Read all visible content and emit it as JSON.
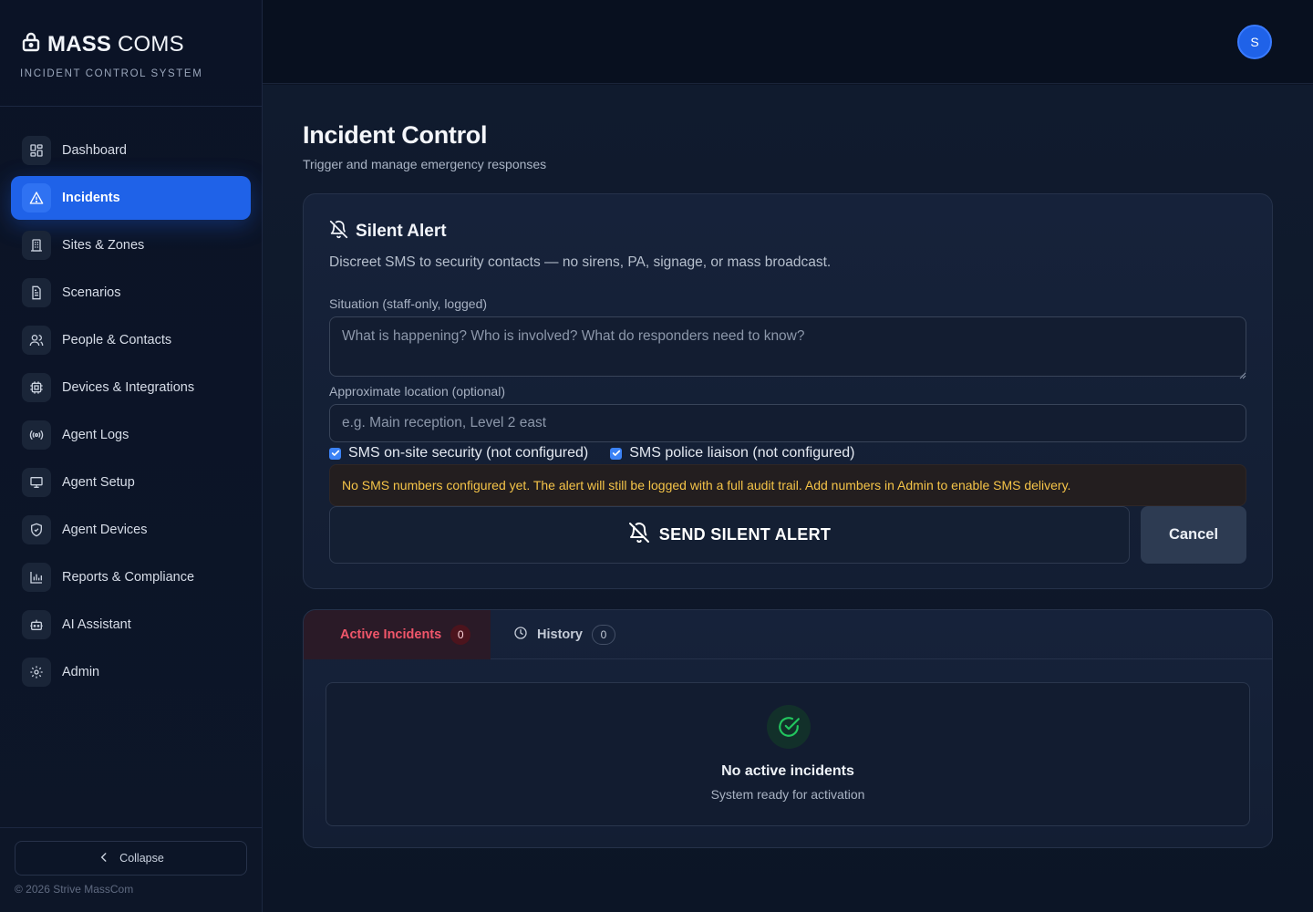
{
  "brand": {
    "name_bold": "MASS",
    "name_light": "COMS",
    "subtitle": "INCIDENT CONTROL SYSTEM"
  },
  "sidebar": {
    "items": [
      {
        "label": "Dashboard",
        "icon": "dashboard-icon"
      },
      {
        "label": "Incidents",
        "icon": "alert-triangle-icon",
        "active": true
      },
      {
        "label": "Sites & Zones",
        "icon": "building-icon"
      },
      {
        "label": "Scenarios",
        "icon": "document-icon"
      },
      {
        "label": "People & Contacts",
        "icon": "users-icon"
      },
      {
        "label": "Devices & Integrations",
        "icon": "chip-icon"
      },
      {
        "label": "Agent Logs",
        "icon": "broadcast-icon"
      },
      {
        "label": "Agent Setup",
        "icon": "monitor-icon"
      },
      {
        "label": "Agent Devices",
        "icon": "shield-icon"
      },
      {
        "label": "Reports & Compliance",
        "icon": "bar-chart-icon"
      },
      {
        "label": "AI Assistant",
        "icon": "bot-icon"
      },
      {
        "label": "Admin",
        "icon": "gear-icon"
      }
    ],
    "collapse_label": "Collapse",
    "copyright": "© 2026 Strive MassCom"
  },
  "header": {
    "avatar_initial": "S"
  },
  "page": {
    "title": "Incident Control",
    "subtitle": "Trigger and manage emergency responses"
  },
  "silent_alert": {
    "title": "Silent Alert",
    "description": "Discreet SMS to security contacts — no sirens, PA, signage, or mass broadcast.",
    "situation_label": "Situation (staff-only, logged)",
    "situation_placeholder": "What is happening? Who is involved? What do responders need to know?",
    "location_label": "Approximate location (optional)",
    "location_placeholder": "e.g. Main reception, Level 2 east",
    "checkbox_security": "SMS on-site security (not configured)",
    "checkbox_police": "SMS police liaison (not configured)",
    "warning": "No SMS numbers configured yet. The alert will still be logged with a full audit trail. Add numbers in Admin to enable SMS delivery.",
    "send_label": "SEND SILENT ALERT",
    "cancel_label": "Cancel"
  },
  "incidents": {
    "tab_active_label": "Active Incidents",
    "tab_active_count": "0",
    "tab_history_label": "History",
    "tab_history_count": "0",
    "empty_title": "No active incidents",
    "empty_subtitle": "System ready for activation"
  },
  "colors": {
    "accent": "#1f62e8",
    "warning_text": "#f5c448",
    "danger_text": "#f0566a",
    "success": "#22c55e"
  }
}
